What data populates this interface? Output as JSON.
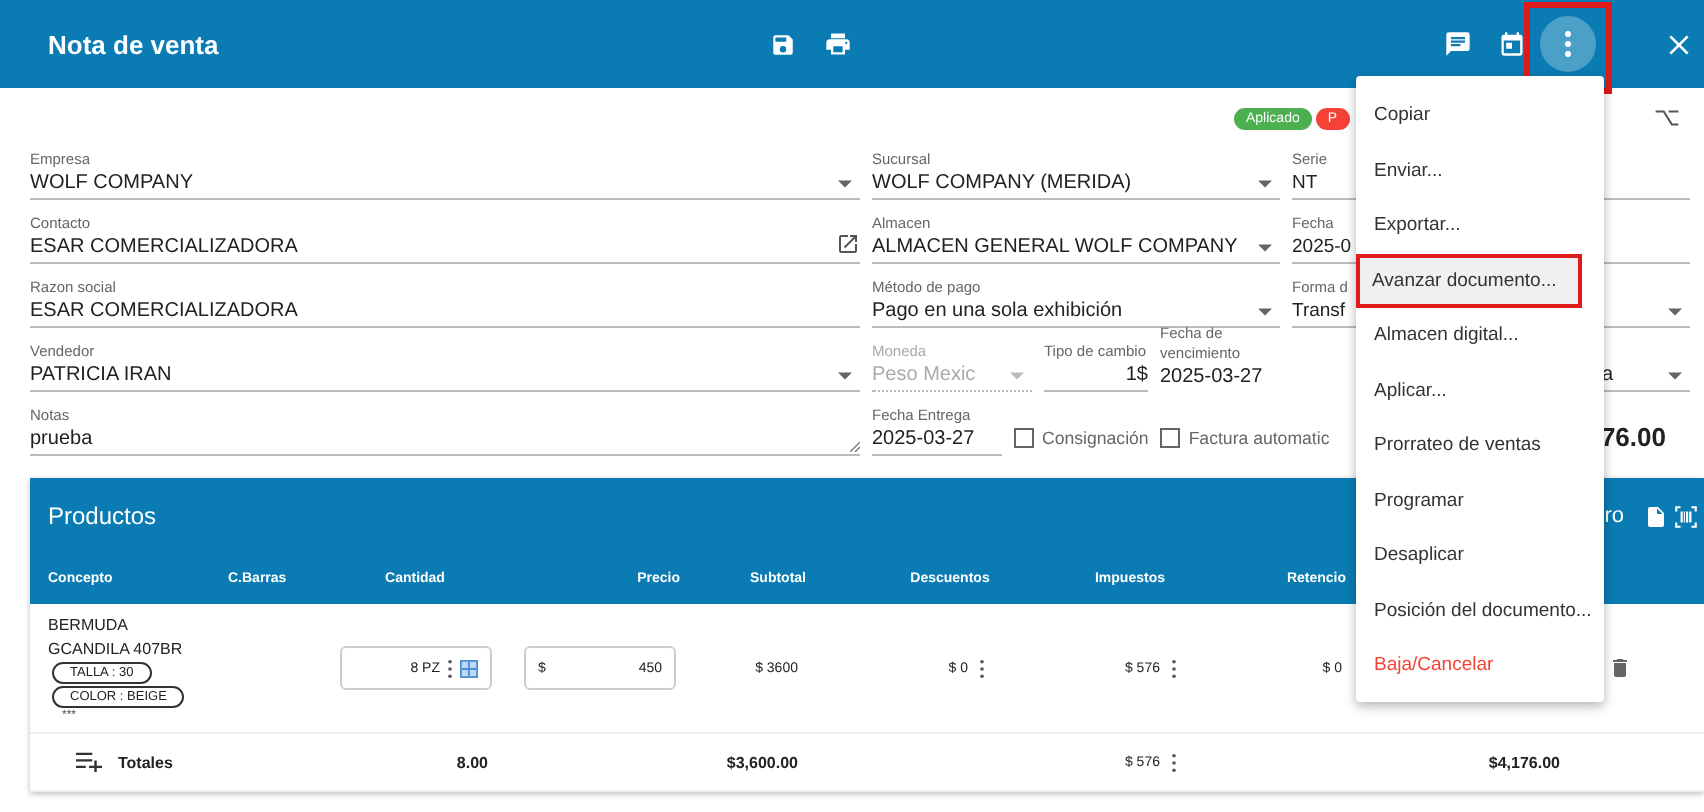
{
  "header": {
    "title": "Nota de venta"
  },
  "badges": [
    {
      "label": "Aplicado",
      "color": "#4caf50"
    },
    {
      "label": "P",
      "color": "#f44336"
    }
  ],
  "fields": {
    "empresa": {
      "label": "Empresa",
      "value": "WOLF COMPANY"
    },
    "sucursal": {
      "label": "Sucursal",
      "value": "WOLF COMPANY (MERIDA)"
    },
    "serie": {
      "label": "Serie",
      "value": "NT"
    },
    "contacto": {
      "label": "Contacto",
      "value": "ESAR COMERCIALIZADORA"
    },
    "almacen": {
      "label": "Almacen",
      "value": "ALMACEN GENERAL WOLF COMPANY"
    },
    "fecha": {
      "label": "Fecha",
      "value": "2025-0"
    },
    "razon_social": {
      "label": "Razon social",
      "value": "ESAR COMERCIALIZADORA"
    },
    "metodo_pago": {
      "label": "Método de pago",
      "value": "Pago en una sola exhibición"
    },
    "forma_pago": {
      "label": "Forma d",
      "value": "Transf"
    },
    "vendedor": {
      "label": "Vendedor",
      "value": "PATRICIA IRAN"
    },
    "moneda": {
      "label": "Moneda",
      "value": "Peso Mexic",
      "disabled": true
    },
    "tipo_cambio": {
      "label": "Tipo de cambio",
      "value": "1$"
    },
    "fecha_vencimiento": {
      "label": "Fecha de vencimiento",
      "value": "2025-03-27"
    },
    "field_cut": {
      "value": "a"
    },
    "notas": {
      "label": "Notas",
      "value": "prueba"
    },
    "fecha_entrega": {
      "label": "Fecha Entrega",
      "value": "2025-03-27"
    }
  },
  "checkboxes": [
    {
      "label": "Consignación",
      "checked": false
    },
    {
      "label": "Factura automatic",
      "checked": false
    }
  ],
  "total_fragment": "76.00",
  "products": {
    "title": "Productos",
    "header_fragment": "ro",
    "columns": [
      "Concepto",
      "C.Barras",
      "Cantidad",
      "Precio",
      "Subtotal",
      "Descuentos",
      "Impuestos",
      "Retencio"
    ],
    "rows": [
      {
        "concept": [
          "BERMUDA",
          "GCANDILA 407BR"
        ],
        "tags": [
          "TALLA : 30",
          "COLOR : BEIGE"
        ],
        "more": "***",
        "cantidad": "8 PZ",
        "precio_symbol": "$",
        "precio": "450",
        "subtotal": "$ 3600",
        "descuentos": "$ 0",
        "impuestos": "$ 576",
        "retenciones": "$ 0"
      }
    ],
    "totals": {
      "label": "Totales",
      "cantidad": "8.00",
      "subtotal": "$3,600.00",
      "impuestos": "$ 576",
      "total": "$4,176.00"
    }
  },
  "menu": [
    {
      "label": "Copiar",
      "kind": "normal",
      "selected": false
    },
    {
      "label": "Enviar...",
      "kind": "normal",
      "selected": false
    },
    {
      "label": "Exportar...",
      "kind": "normal",
      "selected": false
    },
    {
      "label": "Avanzar documento...",
      "kind": "normal",
      "selected": true
    },
    {
      "label": "Almacen digital...",
      "kind": "normal",
      "selected": false
    },
    {
      "label": "Aplicar...",
      "kind": "normal",
      "selected": false
    },
    {
      "label": "Prorrateo de ventas",
      "kind": "normal",
      "selected": false
    },
    {
      "label": "Programar",
      "kind": "normal",
      "selected": false
    },
    {
      "label": "Desaplicar",
      "kind": "normal",
      "selected": false
    },
    {
      "label": "Posición del documento...",
      "kind": "normal",
      "selected": false
    },
    {
      "label": "Baja/Cancelar",
      "kind": "danger",
      "selected": false
    }
  ]
}
